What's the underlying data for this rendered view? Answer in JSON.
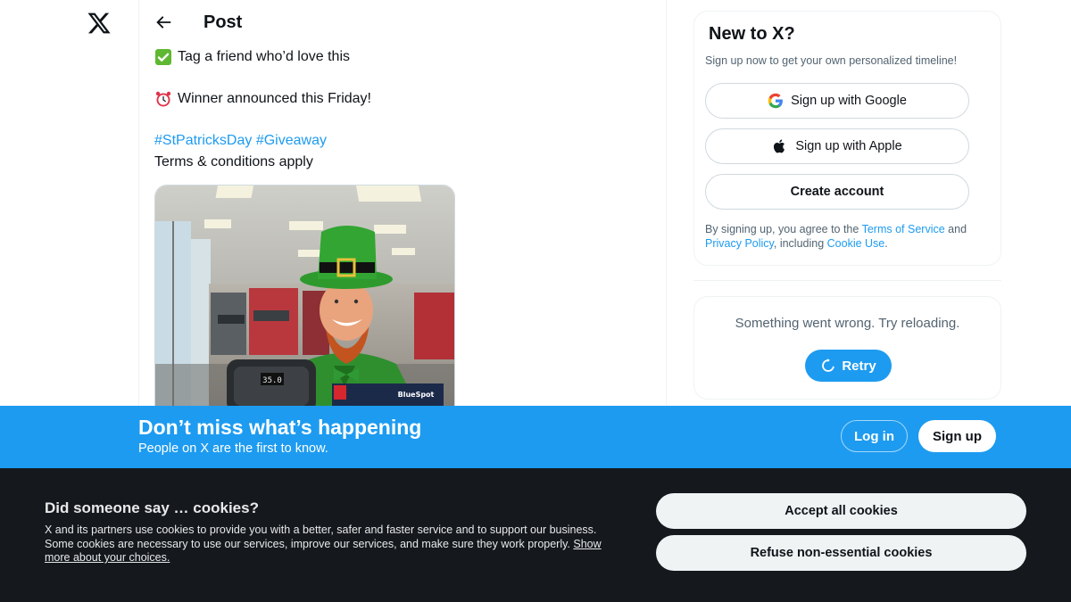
{
  "nav": {
    "logo_icon": "x-logo-icon"
  },
  "post": {
    "back_icon": "arrow-left-icon",
    "title": "Post",
    "lines": [
      {
        "emoji": "check-mark-button-icon",
        "text": "Tag a friend who’d love this"
      },
      {
        "emoji": "alarm-clock-icon",
        "text": "Winner announced this Friday!"
      }
    ],
    "hashtags": [
      "#StPatricksDay",
      "#Giveaway"
    ],
    "terms": "Terms & conditions apply",
    "media": {
      "description_icon": "photo-image",
      "device_display": "35.0",
      "brand_box": "BlueSpot"
    }
  },
  "signup_card": {
    "title": "New to X?",
    "subtitle": "Sign up now to get your own personalized timeline!",
    "google_label": "Sign up with Google",
    "apple_label": "Sign up with Apple",
    "create_label": "Create account",
    "legal_prefix": "By signing up, you agree to the ",
    "legal_tos": "Terms of Service",
    "legal_and": " and ",
    "legal_privacy": "Privacy Policy",
    "legal_including": ", including ",
    "legal_cookie": "Cookie Use",
    "legal_end": "."
  },
  "error_card": {
    "message": "Something went wrong. Try reloading.",
    "retry_label": "Retry"
  },
  "banner": {
    "title": "Don’t miss what’s happening",
    "subtitle": "People on X are the first to know.",
    "login_label": "Log in",
    "signup_label": "Sign up"
  },
  "cookies": {
    "title": "Did someone say … cookies?",
    "body": "X and its partners use cookies to provide you with a better, safer and faster service and to support our business. Some cookies are necessary to use our services, improve our services, and make sure they work properly. ",
    "link": "Show more about your choices.",
    "accept_label": "Accept all cookies",
    "refuse_label": "Refuse non-essential cookies"
  },
  "colors": {
    "accent": "#1d9bf0",
    "text": "#0f1419",
    "muted": "#536471",
    "cookie_bg": "#15181c"
  }
}
